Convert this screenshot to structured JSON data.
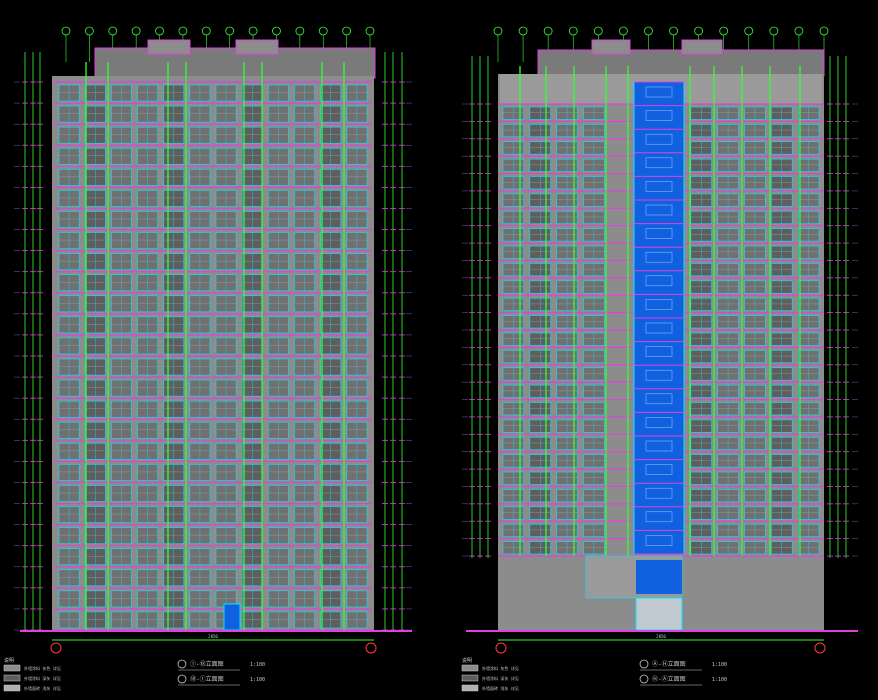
{
  "colors": {
    "background": "#000000",
    "facade": "#8c8c8c",
    "facade_dark": "#5e5e5e",
    "window_line": "#00e5ff",
    "column_line": "#33ff33",
    "floor_band": "#e040e0",
    "dimension": "#33ff33",
    "glass_core": "#1060e0",
    "axis_bubble": "#ff3b3b",
    "text": "#c8c8c8"
  },
  "drawings": [
    {
      "view": "front-elevation",
      "floors": 26,
      "bays": 12,
      "grid_bubbles": 14,
      "title_lines": [
        "①-⑱立面图",
        "⑱-①立面图"
      ],
      "scale_lines": [
        "1:100",
        "1:100"
      ],
      "legend_rows": [
        "外墙涂料 灰色 详见",
        "外墙涂料 深灰 详见",
        "外墙面砖 浅灰 详见"
      ]
    },
    {
      "view": "rear-elevation",
      "floors": 26,
      "bays": 12,
      "grid_bubbles": 14,
      "title_lines": [
        "Ⓐ-Ⓗ立面图",
        "Ⓗ-Ⓐ立面图"
      ],
      "scale_lines": [
        "1:100",
        "1:100"
      ],
      "legend_rows": [
        "外墙涂料 灰色 详见",
        "外墙涂料 深灰 详见",
        "外墙面砖 浅灰 详见"
      ]
    }
  ]
}
